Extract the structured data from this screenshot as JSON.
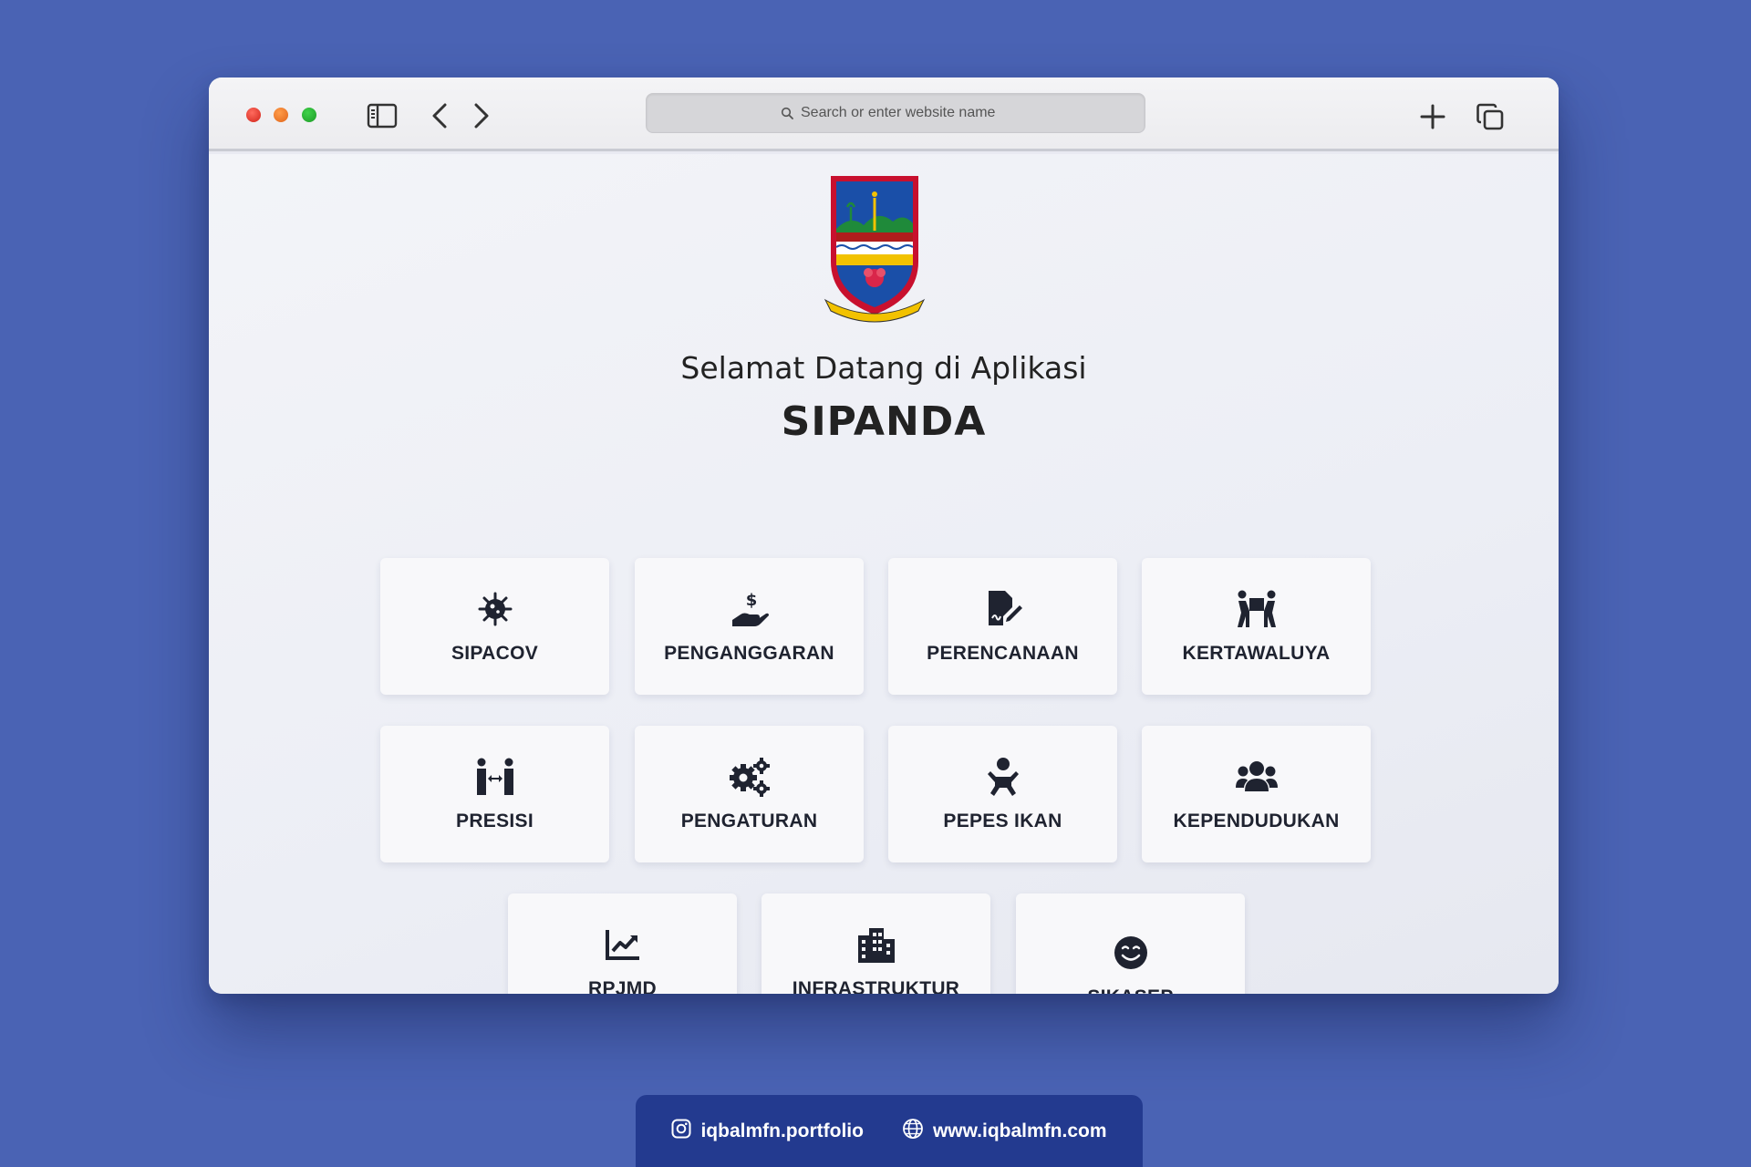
{
  "browser": {
    "search_placeholder": "Search or enter website name",
    "icons": [
      "sidebar-icon",
      "back-icon",
      "forward-icon",
      "new-tab-icon",
      "tabs-overview-icon",
      "search-icon"
    ]
  },
  "header": {
    "welcome": "Selamat Datang di Aplikasi",
    "app_name": "SIPANDA"
  },
  "menu": {
    "items": [
      {
        "label": "SIPACOV",
        "icon": "virus-icon"
      },
      {
        "label": "PENGANGGARAN",
        "icon": "hand-dollar-icon"
      },
      {
        "label": "PERENCANAAN",
        "icon": "file-signature-icon"
      },
      {
        "label": "KERTAWALUYA",
        "icon": "people-carry-icon"
      },
      {
        "label": "PRESISI",
        "icon": "people-arrows-icon"
      },
      {
        "label": "PENGATURAN",
        "icon": "cogs-icon"
      },
      {
        "label": "PEPES IKAN",
        "icon": "baby-icon"
      },
      {
        "label": "KEPENDUDUKAN",
        "icon": "users-icon"
      },
      {
        "label": "RPJMD",
        "icon": "chart-line-icon"
      },
      {
        "label": "INFRASTRUKTUR",
        "icon": "building-icon"
      },
      {
        "label": "SIKASEP",
        "icon": "smile-icon"
      }
    ]
  },
  "footer": {
    "instagram": "iqbalmfn.portfolio",
    "website": "www.iqbalmfn.com"
  },
  "colors": {
    "background": "#4a63b4",
    "footer": "#233a8f",
    "text": "#1f2330"
  }
}
